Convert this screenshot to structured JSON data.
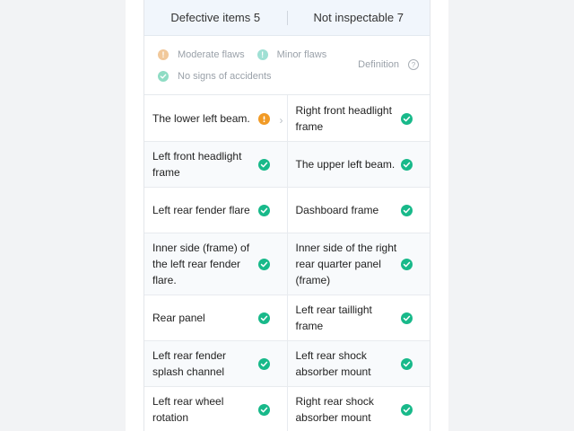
{
  "tabs": [
    {
      "label": "Defective items 5"
    },
    {
      "label": "Not inspectable 7"
    }
  ],
  "legend": {
    "moderate": "Moderate flaws",
    "minor": "Minor flaws",
    "none": "No signs of accidents",
    "definition": "Definition"
  },
  "colors": {
    "ok": "#18b98a",
    "warn": "#f19a25"
  },
  "grid": {
    "rows": [
      [
        {
          "label": "The lower left beam.",
          "status": "moderate-flaw-icon"
        },
        {
          "label": "Right front headlight frame",
          "status": "check-icon"
        }
      ],
      [
        {
          "label": "Left front headlight frame",
          "status": "check-icon"
        },
        {
          "label": "The upper left beam.",
          "status": "check-icon"
        }
      ],
      [
        {
          "label": "Left rear fender flare",
          "status": "check-icon"
        },
        {
          "label": "Dashboard frame",
          "status": "check-icon"
        }
      ],
      [
        {
          "label": "Inner side (frame) of the left rear fender flare.",
          "status": "check-icon"
        },
        {
          "label": "Inner side of the right rear quarter panel (frame)",
          "status": "check-icon"
        }
      ],
      [
        {
          "label": "Rear panel",
          "status": "check-icon"
        },
        {
          "label": "Left rear taillight frame",
          "status": "check-icon"
        }
      ],
      [
        {
          "label": "Left rear fender splash channel",
          "status": "check-icon"
        },
        {
          "label": "Left rear shock absorber mount",
          "status": "check-icon"
        }
      ],
      [
        {
          "label": "Left rear wheel rotation",
          "status": "check-icon"
        },
        {
          "label": "Right rear shock absorber mount",
          "status": "check-icon"
        }
      ]
    ]
  }
}
